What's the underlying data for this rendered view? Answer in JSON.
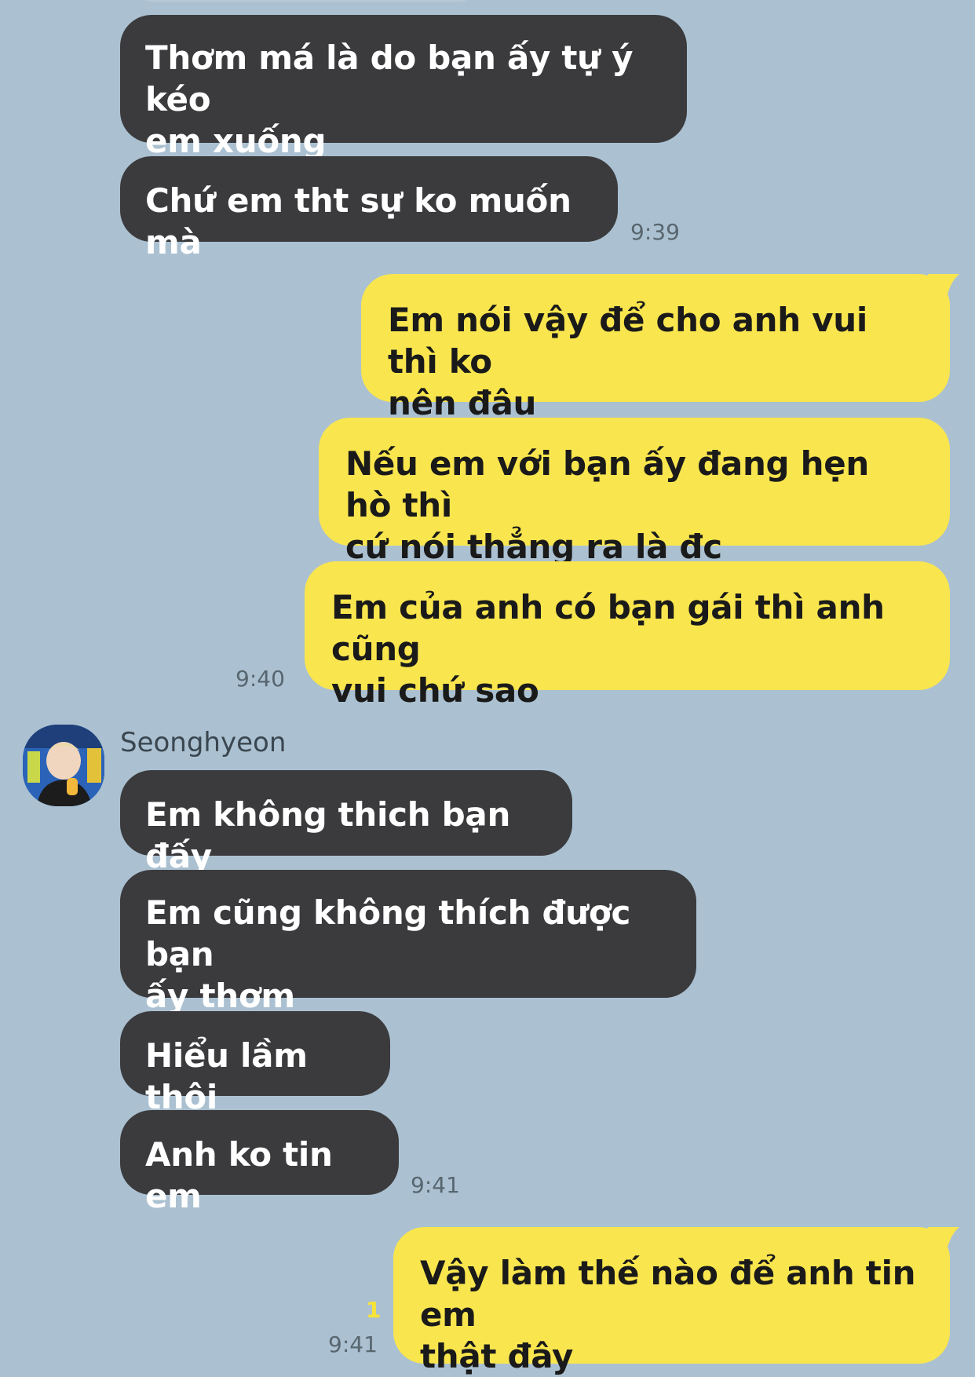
{
  "colors": {
    "background": "#abc1d1",
    "incoming_bubble": "#3b3b3e",
    "outgoing_bubble": "#f9e54e",
    "timestamp": "#58666f",
    "unread_count": "#f7e437"
  },
  "contact": {
    "name": "Seonghyeon",
    "avatar_icon": "profile-photo-icon"
  },
  "messages": [
    {
      "direction": "incoming",
      "text": "Thơm má là do bạn ấy tự ý kéo\nem xuống"
    },
    {
      "direction": "incoming",
      "text": "Chứ em tht sự ko muốn mà",
      "time": "9:39"
    },
    {
      "direction": "outgoing",
      "text": "Em nói vậy để cho anh vui thì ko\nnên đâu"
    },
    {
      "direction": "outgoing",
      "text": "Nếu em với bạn ấy đang hẹn hò thì\ncứ nói thẳng ra là đc"
    },
    {
      "direction": "outgoing",
      "text": "Em của anh có bạn gái thì anh cũng\nvui chứ sao",
      "time": "9:40"
    },
    {
      "direction": "incoming",
      "text": "Em không thich bạn đấy"
    },
    {
      "direction": "incoming",
      "text": "Em cũng không thích được bạn\nấy thơm"
    },
    {
      "direction": "incoming",
      "text": "Hiểu lầm thôi"
    },
    {
      "direction": "incoming",
      "text": "Anh ko tin em",
      "time": "9:41"
    },
    {
      "direction": "outgoing",
      "text": "Vậy làm thế nào để anh tin em\nthật đây",
      "time": "9:41",
      "unread": "1"
    }
  ]
}
